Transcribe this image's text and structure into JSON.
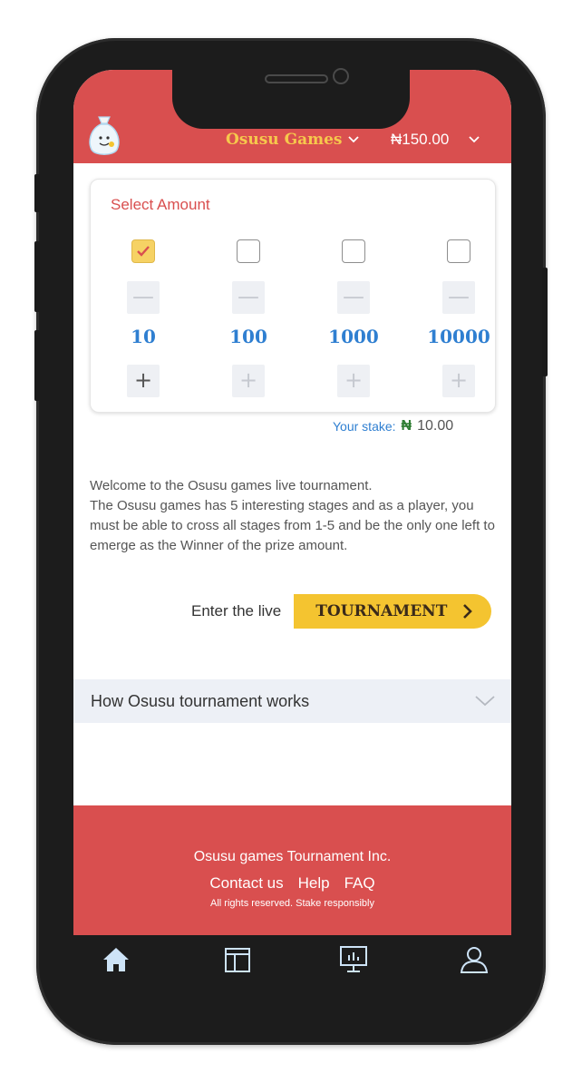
{
  "header": {
    "brand": "Osusu Games",
    "balance": "₦150.00",
    "logo_icon": "money-bag-icon",
    "colors": {
      "header_bg": "#d94f4f",
      "brand": "#f6c84c"
    }
  },
  "select_amount": {
    "title": "Select Amount",
    "options": [
      {
        "amount": "10",
        "checked": true
      },
      {
        "amount": "100",
        "checked": false
      },
      {
        "amount": "1000",
        "checked": false
      },
      {
        "amount": "10000",
        "checked": false
      }
    ],
    "minus_symbol": "—",
    "plus_symbol": "+"
  },
  "stake": {
    "label": "Your stake:",
    "currency_symbol": "₦",
    "value": "10.00"
  },
  "intro": {
    "line1": "Welcome to the Osusu games live tournament.",
    "line2": "The Osusu games has 5 interesting stages and as a player, you must be able to cross all stages from 1-5 and be the only one left to emerge as the Winner of the prize amount."
  },
  "cta": {
    "label": "Enter the live",
    "button": "TOURNAMENT",
    "button_color": "#f4c430"
  },
  "accordion": {
    "title": "How Osusu tournament works"
  },
  "footer": {
    "company": "Osusu games Tournament Inc.",
    "links": [
      "Contact us",
      "Help",
      "FAQ"
    ],
    "legal": "All rights reserved.  Stake responsibly"
  },
  "bottom_nav": {
    "items": [
      "home-icon",
      "window-icon",
      "presentation-icon",
      "user-icon"
    ]
  }
}
